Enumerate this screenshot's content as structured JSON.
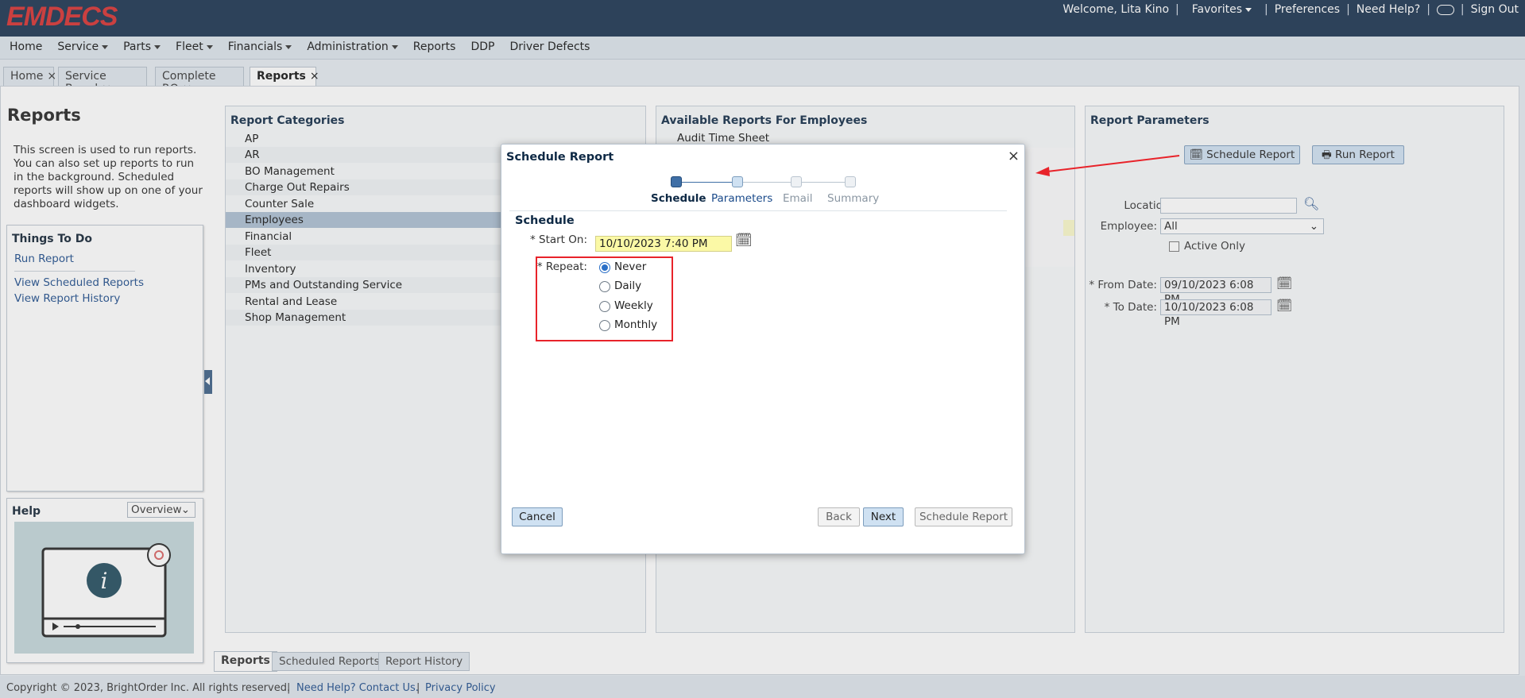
{
  "header": {
    "logo": "EMDECS",
    "welcome": "Welcome, Lita Kino",
    "favorites": "Favorites",
    "preferences": "Preferences",
    "help": "Need Help?",
    "signout": "Sign Out",
    "separator": "|"
  },
  "menu": {
    "home": "Home",
    "service": "Service",
    "parts": "Parts",
    "fleet": "Fleet",
    "financials": "Financials",
    "administration": "Administration",
    "reports": "Reports",
    "ddp": "DDP",
    "driver_defects": "Driver Defects"
  },
  "tabs": [
    "Home",
    "Service Board",
    "Complete RO",
    "Reports"
  ],
  "tab_close": "×",
  "left": {
    "title": "Reports",
    "description": "This screen is used to run reports. You can also set up reports to run in the background. Scheduled reports will show up on one of your dashboard widgets.",
    "things_to_do_title": "Things To Do",
    "run_report": "Run Report",
    "view_scheduled": "View Scheduled Reports",
    "view_history": "View Report History",
    "help_title": "Help",
    "help_select": "Overview"
  },
  "categories": {
    "title": "Report Categories",
    "items": [
      "AP",
      "AR",
      "BO Management",
      "Charge Out Repairs",
      "Counter Sale",
      "Employees",
      "Financial",
      "Fleet",
      "Inventory",
      "PMs and Outstanding Service",
      "Rental and Lease",
      "Shop Management"
    ],
    "selected": "Employees"
  },
  "available": {
    "title": "Available Reports For Employees",
    "first_item": "Audit Time Sheet"
  },
  "params": {
    "title": "Report Parameters",
    "schedule_btn": "Schedule Report",
    "run_btn": "Run Report",
    "location_label": "Location:",
    "employee_label": "Employee:",
    "employee_value": "All",
    "active_only": "Active Only",
    "from_label": "* From Date:",
    "from_value": "09/10/2023 6:08 PM",
    "to_label": "* To Date:",
    "to_value": "10/10/2023 6:08 PM"
  },
  "bottom_tabs": [
    "Reports",
    "Scheduled Reports",
    "Report History"
  ],
  "footer": {
    "copyright": "Copyright © 2023, BrightOrder Inc. All rights reserved.",
    "contact": "Need Help? Contact Us.",
    "privacy": "Privacy Policy",
    "separator": "|"
  },
  "dialog": {
    "title": "Schedule Report",
    "close": "×",
    "steps": [
      "Schedule",
      "Parameters",
      "Email",
      "Summary"
    ],
    "section": "Schedule",
    "start_label": "* Start On:",
    "start_value": "10/10/2023 7:40 PM",
    "repeat_label": "* Repeat:",
    "repeat_options": [
      "Never",
      "Daily",
      "Weekly",
      "Monthly"
    ],
    "repeat_selected": "Never",
    "cancel": "Cancel",
    "back": "Back",
    "next": "Next",
    "schedule": "Schedule Report"
  },
  "colors": {
    "header_bg": "#17304d",
    "logo_red": "#d62e2e",
    "annotation_red": "#e8232a",
    "selected_row": "#aabdd1",
    "start_field_bg": "#fbf9a6"
  }
}
